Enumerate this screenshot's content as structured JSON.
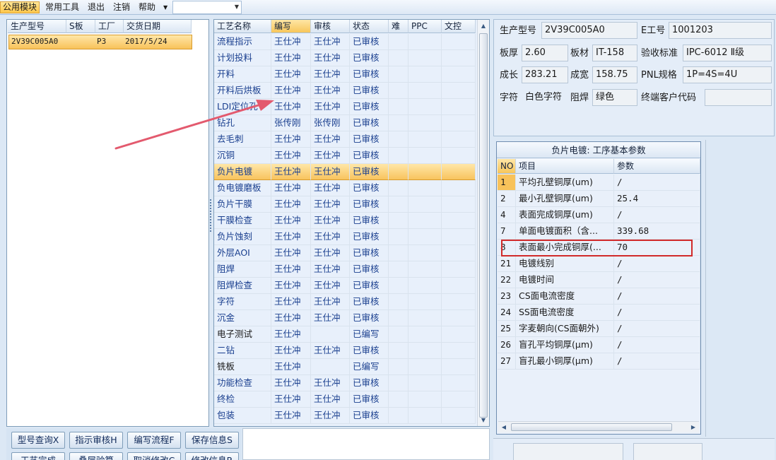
{
  "menu": [
    {
      "label": "公用模块",
      "active": true
    },
    {
      "label": "常用工具"
    },
    {
      "label": "退出"
    },
    {
      "label": "注销"
    },
    {
      "label": "帮助"
    }
  ],
  "models": {
    "headers": [
      "生产型号",
      "S板",
      "工厂",
      "交货日期"
    ],
    "rows": [
      [
        "2V39C005A0",
        "",
        "P3",
        "2017/5/24"
      ]
    ]
  },
  "process": {
    "headers": [
      "工艺名称",
      "编写",
      "审核",
      "状态",
      "难",
      "PPC",
      "文控"
    ],
    "rows": [
      [
        "流程指示",
        "王仕冲",
        "王仕冲",
        "已审核"
      ],
      [
        "计划投料",
        "王仕冲",
        "王仕冲",
        "已审核"
      ],
      [
        "开料",
        "王仕冲",
        "王仕冲",
        "已审核"
      ],
      [
        "开料后烘板",
        "王仕冲",
        "王仕冲",
        "已审核"
      ],
      [
        "LDI定位孔",
        "王仕冲",
        "王仕冲",
        "已审核"
      ],
      [
        "钻孔",
        "张传刚",
        "张传刚",
        "已审核"
      ],
      [
        "去毛刺",
        "王仕冲",
        "王仕冲",
        "已审核"
      ],
      [
        "沉铜",
        "王仕冲",
        "王仕冲",
        "已审核"
      ],
      [
        "负片电镀",
        "王仕冲",
        "王仕冲",
        "已审核"
      ],
      [
        "负电镀磨板",
        "王仕冲",
        "王仕冲",
        "已审核"
      ],
      [
        "负片干膜",
        "王仕冲",
        "王仕冲",
        "已审核"
      ],
      [
        "干膜检查",
        "王仕冲",
        "王仕冲",
        "已审核"
      ],
      [
        "负片蚀刻",
        "王仕冲",
        "王仕冲",
        "已审核"
      ],
      [
        "外层AOI",
        "王仕冲",
        "王仕冲",
        "已审核"
      ],
      [
        "阻焊",
        "王仕冲",
        "王仕冲",
        "已审核"
      ],
      [
        "阻焊检查",
        "王仕冲",
        "王仕冲",
        "已审核"
      ],
      [
        "字符",
        "王仕冲",
        "王仕冲",
        "已审核"
      ],
      [
        "沉金",
        "王仕冲",
        "王仕冲",
        "已审核"
      ],
      [
        "电子测试",
        "王仕冲",
        "",
        "已编写"
      ],
      [
        "二钻",
        "王仕冲",
        "王仕冲",
        "已审核"
      ],
      [
        "铣板",
        "王仕冲",
        "",
        "已编写"
      ],
      [
        "功能检查",
        "王仕冲",
        "王仕冲",
        "已审核"
      ],
      [
        "终检",
        "王仕冲",
        "王仕冲",
        "已审核"
      ],
      [
        "包装",
        "王仕冲",
        "王仕冲",
        "已审核"
      ]
    ],
    "selected_row": 8
  },
  "info": {
    "model_label": "生产型号",
    "model_value": "2V39C005A0",
    "e_label": "E工号",
    "e_value": "1001203",
    "thick_label": "板厚",
    "thick_value": "2.60",
    "material_label": "板材",
    "material_value": "IT-158",
    "standard_label": "验收标准",
    "standard_value": "IPC-6012 Ⅱ级",
    "length_label": "成长",
    "length_value": "283.21",
    "width_label": "成宽",
    "width_value": "158.75",
    "pnl_label": "PNL规格",
    "pnl_value": "1P=4S=4U",
    "char_label": "字符",
    "char_value": "白色字符",
    "mask_label": "阻焊",
    "mask_value": "绿色",
    "customer_label": "终端客户代码",
    "customer_value": ""
  },
  "params": {
    "title": "负片电镀: 工序基本参数",
    "headers": [
      "NO",
      "项目",
      "参数"
    ],
    "rows": [
      [
        "1",
        "平均孔壁铜厚(um)",
        "/"
      ],
      [
        "2",
        "最小孔壁铜厚(um)",
        "25.4"
      ],
      [
        "4",
        "表面完成铜厚(um)",
        "/"
      ],
      [
        "7",
        "单面电镀面积（含...",
        "339.68"
      ],
      [
        "8",
        "表面最小完成铜厚(...",
        "70"
      ],
      [
        "21",
        "电镀线别",
        "/"
      ],
      [
        "22",
        "电镀时间",
        "/"
      ],
      [
        "23",
        "CS面电流密度",
        "/"
      ],
      [
        "24",
        "SS面电流密度",
        "/"
      ],
      [
        "25",
        "字麦朝向(CS面朝外)",
        "/"
      ],
      [
        "26",
        "盲孔平均铜厚(μm)",
        "/"
      ],
      [
        "27",
        "盲孔最小铜厚(μm)",
        "/"
      ]
    ],
    "highlighted_row": 4
  },
  "buttons": [
    {
      "label": "型号查询X",
      "name": "model-query-button"
    },
    {
      "label": "指示审核H",
      "name": "instruction-review-button"
    },
    {
      "label": "编写流程F",
      "name": "write-flow-button"
    },
    {
      "label": "保存信息S",
      "name": "save-info-button"
    },
    {
      "label": "工艺完成",
      "name": "process-complete-button"
    },
    {
      "label": "叠层验算",
      "name": "stackup-check-button"
    },
    {
      "label": "取消修改C",
      "name": "cancel-edit-button"
    },
    {
      "label": "修改信息R",
      "name": "edit-info-button"
    }
  ],
  "colors": {
    "accent_selected": "#f8c25a",
    "link_text": "#1a3f8f",
    "annotation_red": "#d12a2a",
    "annotation_arrow": "#e35a6e"
  }
}
